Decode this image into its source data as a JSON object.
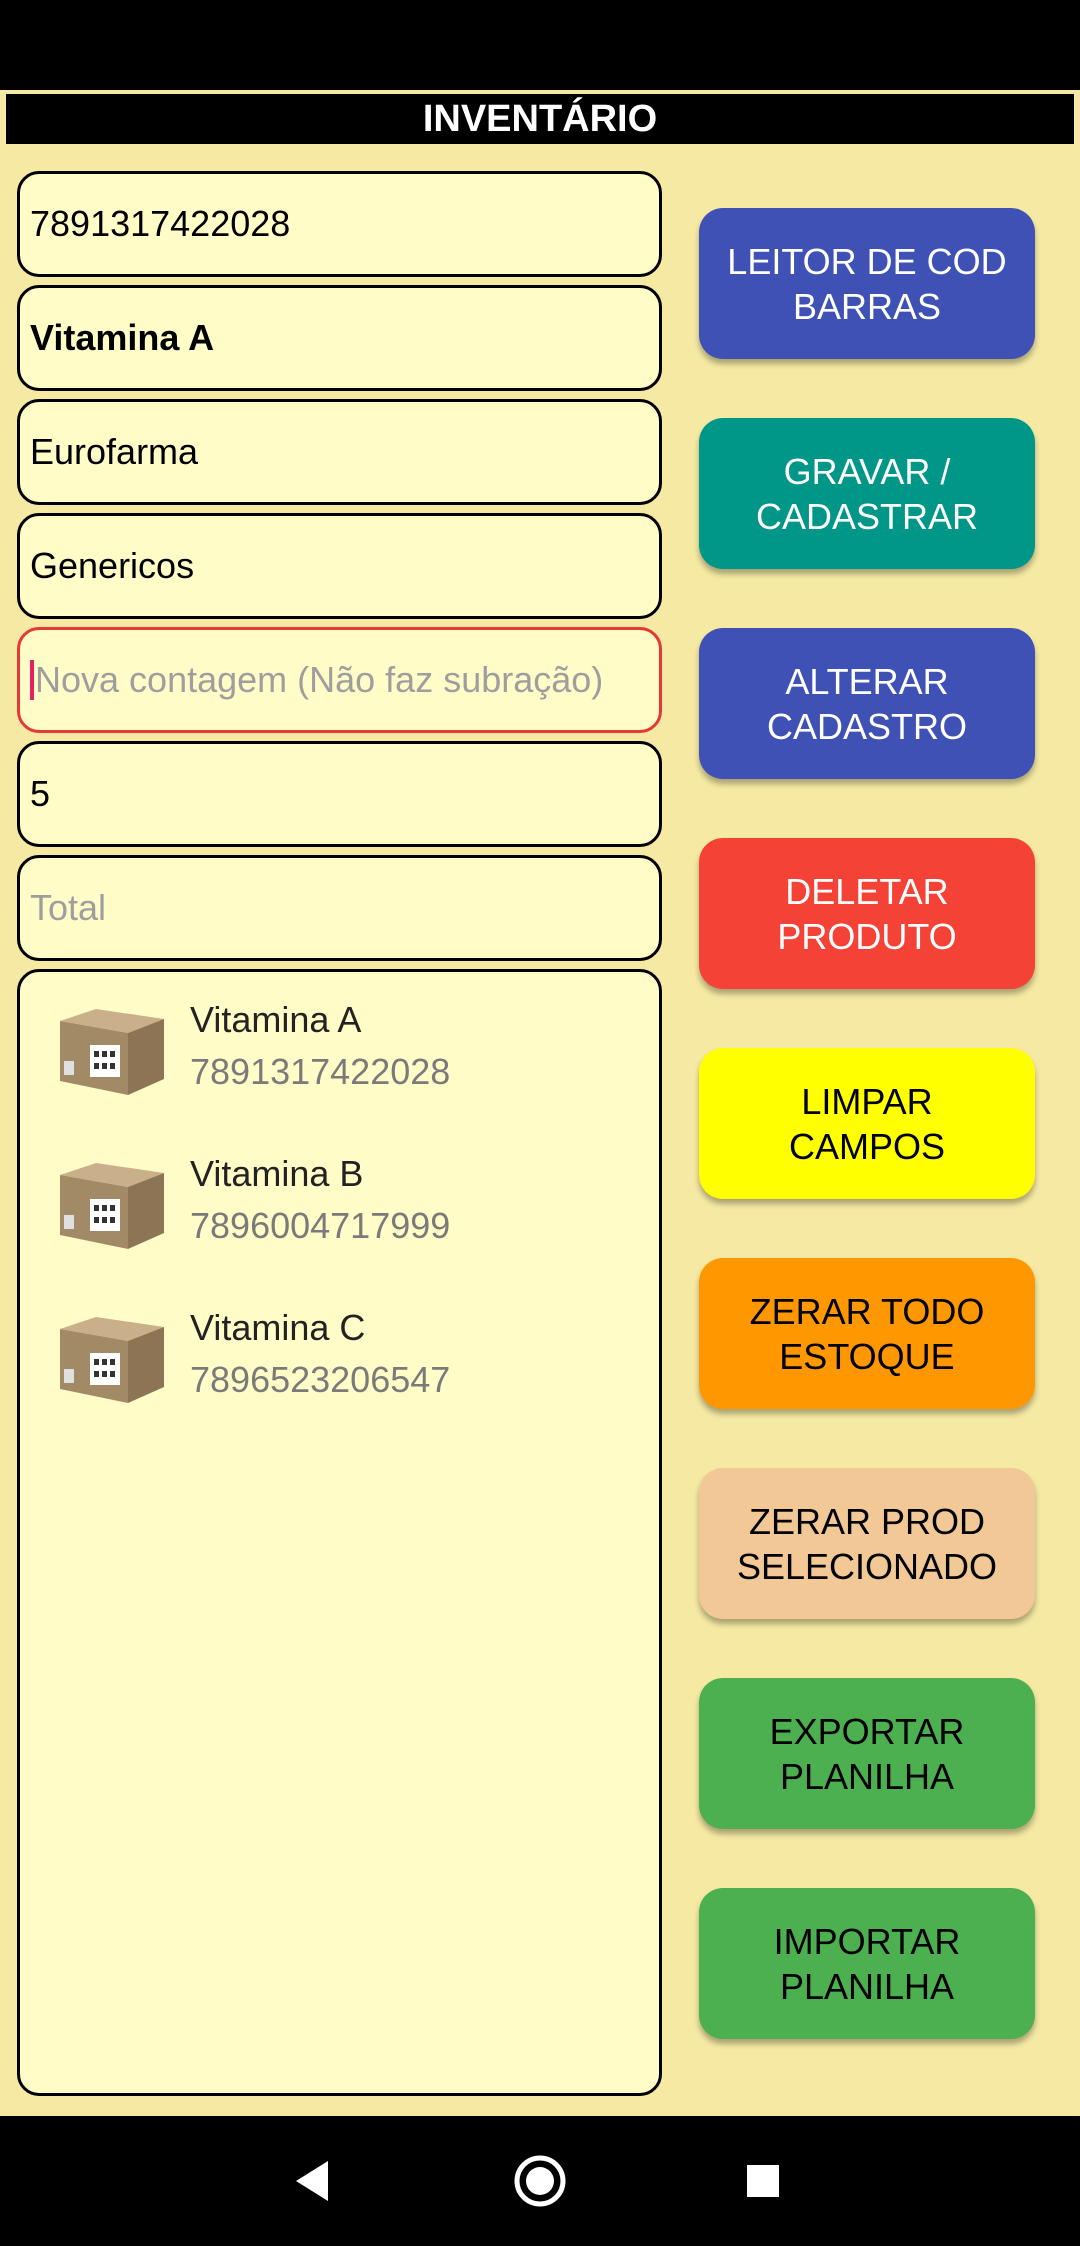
{
  "app": {
    "title": "INVENTÁRIO"
  },
  "form": {
    "barcode": "7891317422028",
    "product_name": "Vitamina A",
    "manufacturer": "Eurofarma",
    "category": "Genericos",
    "new_count_placeholder": "Nova contagem (Não faz subração)",
    "quantity": "5",
    "total_placeholder": "Total"
  },
  "products": [
    {
      "name": "Vitamina A",
      "code": "7891317422028",
      "icon": "box-icon"
    },
    {
      "name": "Vitamina B",
      "code": "7896004717999",
      "icon": "box-icon"
    },
    {
      "name": "Vitamina C",
      "code": "7896523206547",
      "icon": "box-icon"
    }
  ],
  "buttons": [
    {
      "label": "LEITOR DE COD\nBARRAS",
      "color": "#3f51b5",
      "text_color": "#ffffff"
    },
    {
      "label": "GRAVAR /\nCADASTRAR",
      "color": "#009688",
      "text_color": "#ffffff"
    },
    {
      "label": "ALTERAR\nCADASTRO",
      "color": "#3f51b5",
      "text_color": "#ffffff"
    },
    {
      "label": "DELETAR\nPRODUTO",
      "color": "#f44336",
      "text_color": "#ffffff"
    },
    {
      "label": "LIMPAR\nCAMPOS",
      "color": "#ffff00",
      "text_color": "#000000"
    },
    {
      "label": "ZERAR TODO\nESTOQUE",
      "color": "#ff9800",
      "text_color": "#000000"
    },
    {
      "label": "ZERAR PROD\nSELECIONADO",
      "color": "#f2c896",
      "text_color": "#000000"
    },
    {
      "label": "EXPORTAR\nPLANILHA",
      "color": "#4caf50",
      "text_color": "#000000"
    },
    {
      "label": "IMPORTAR\nPLANILHA",
      "color": "#4caf50",
      "text_color": "#000000"
    }
  ],
  "nav": {
    "back_icon": "back-icon",
    "home_icon": "home-icon",
    "recents_icon": "recents-icon"
  }
}
